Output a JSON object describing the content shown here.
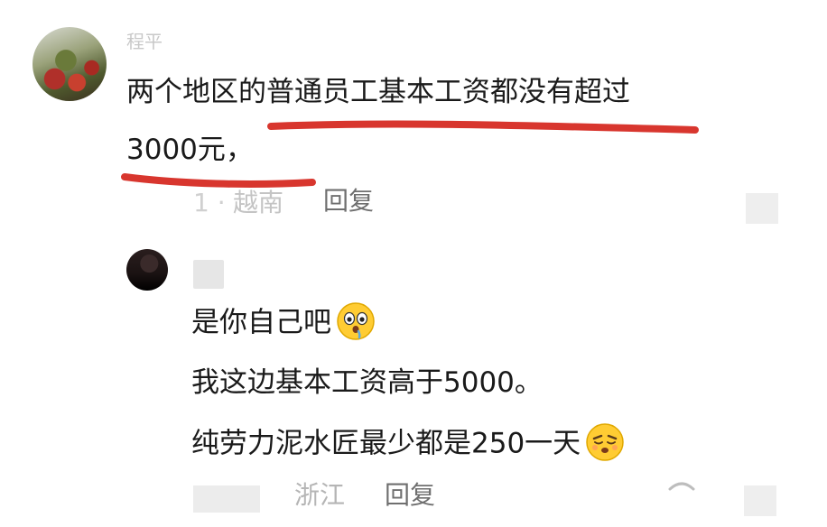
{
  "comment_1": {
    "username": "程平",
    "lines": [
      "两个地区的普通员工基本工资都没有超过",
      "3000元，"
    ],
    "region": "越南",
    "dot": "1 ·",
    "reply_label": "回复"
  },
  "comment_2": {
    "lines": [
      "是你自己吧",
      "我这边基本工资高于5000。",
      "纯劳力泥水匠最少都是250一天"
    ],
    "emoji_1": "drooling-teary-face-icon",
    "emoji_2": "shy-tongue-face-icon",
    "region": "浙江",
    "reply_label": "回复"
  },
  "colors": {
    "underline": "#d8362e",
    "text": "#1a1a1a",
    "meta": "#8a8a8a"
  }
}
